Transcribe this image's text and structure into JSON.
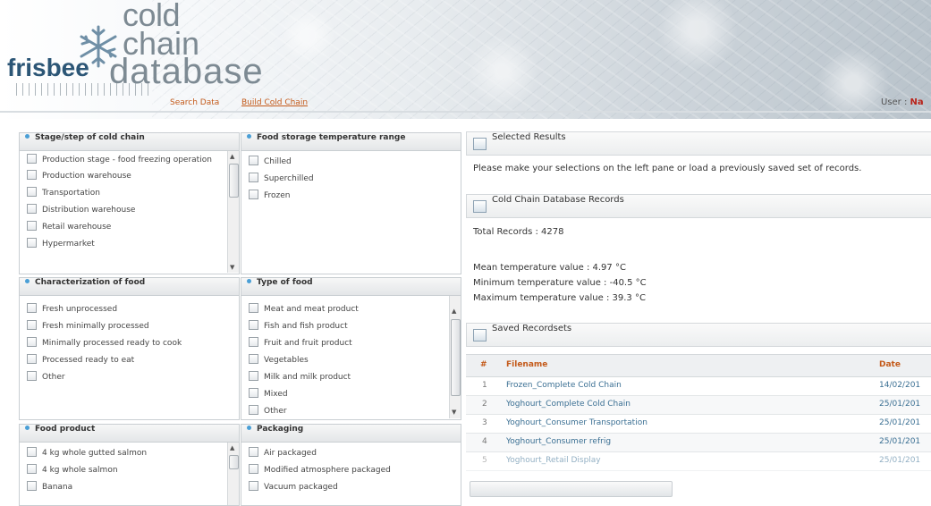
{
  "header": {
    "logo": {
      "word1": "cold",
      "word2": "chain",
      "brand": "frisbee",
      "word3": "database"
    },
    "nav": {
      "search": "Search Data",
      "build": "Build Cold Chain"
    },
    "user_label": "User : ",
    "user_name": "Na"
  },
  "panels": {
    "stage": {
      "title": "Stage/step of cold chain",
      "items": [
        "Production stage - food freezing operation",
        "Production warehouse",
        "Transportation",
        "Distribution warehouse",
        "Retail warehouse",
        "Hypermarket"
      ]
    },
    "temp_range": {
      "title": "Food storage temperature range",
      "items": [
        "Chilled",
        "Superchilled",
        "Frozen"
      ]
    },
    "characterization": {
      "title": "Characterization of food",
      "items": [
        "Fresh unprocessed",
        "Fresh minimally processed",
        "Minimally processed ready to cook",
        "Processed ready to eat",
        "Other"
      ]
    },
    "type": {
      "title": "Type of food",
      "items": [
        "Meat and meat product",
        "Fish and fish product",
        "Fruit and fruit product",
        "Vegetables",
        "Milk and milk product",
        "Mixed",
        "Other"
      ]
    },
    "product": {
      "title": "Food product",
      "items": [
        "4 kg whole gutted salmon",
        "4 kg whole salmon",
        "Banana"
      ]
    },
    "packaging": {
      "title": "Packaging",
      "items": [
        "Air packaged",
        "Modified atmosphere packaged",
        "Vacuum packaged"
      ]
    }
  },
  "results": {
    "selected_title": "Selected Results",
    "selected_msg": "Please make your selections on the left pane or load a previously saved set of records.",
    "records_title": "Cold Chain Database Records",
    "total": "Total Records : 4278",
    "mean": "Mean temperature value : 4.97 °C",
    "min": "Minimum temperature value : -40.5 °C",
    "max": "Maximum temperature value : 39.3 °C"
  },
  "saved": {
    "title": "Saved Recordsets",
    "columns": {
      "num": "#",
      "filename": "Filename",
      "date": "Date"
    },
    "rows": [
      {
        "num": "1",
        "filename": "Frozen_Complete Cold Chain",
        "date": "14/02/201"
      },
      {
        "num": "2",
        "filename": "Yoghourt_Complete Cold Chain",
        "date": "25/01/201"
      },
      {
        "num": "3",
        "filename": "Yoghourt_Consumer Transportation",
        "date": "25/01/201"
      },
      {
        "num": "4",
        "filename": "Yoghourt_Consumer refrig",
        "date": "25/01/201"
      },
      {
        "num": "5",
        "filename": "Yoghourt_Retail Display",
        "date": "25/01/201"
      }
    ]
  }
}
